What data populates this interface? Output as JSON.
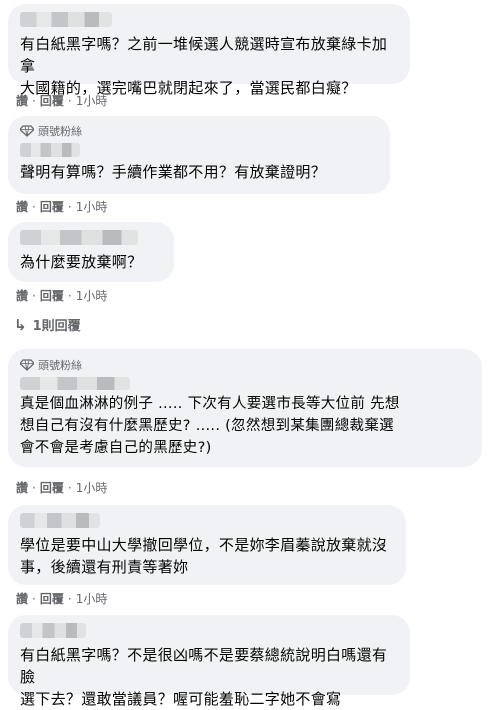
{
  "comments": [
    {
      "text_lines": [
        "有白紙黑字嗎？之前一堆候選人競選時宣布放棄綠卡加拿",
        "大國籍的，選完嘴巴就閉起來了，當選民都白癡？"
      ],
      "actions": {
        "like": "讚",
        "dot": "·",
        "reply": "回覆",
        "time": "1小時"
      }
    },
    {
      "badge": "頭號粉絲",
      "text_lines": [
        "聲明有算嗎？手續作業都不用？有放棄證明？"
      ],
      "actions": {
        "like": "讚",
        "dot": "·",
        "reply": "回覆",
        "time": "1小時"
      }
    },
    {
      "text_lines": [
        "為什麼要放棄啊？"
      ],
      "actions": {
        "like": "讚",
        "dot": "·",
        "reply": "回覆",
        "time": "1小時"
      }
    },
    {
      "badge": "頭號粉絲",
      "text_lines": [
        "真是個血淋淋的例子 ..... 下次有人要選市長等大位前 先想",
        "想自己有沒有什麼黑歷史? ..... (忽然想到某集團總裁棄選",
        "會不會是考慮自己的黑歷史?)"
      ],
      "actions": {
        "like": "讚",
        "dot": "·",
        "reply": "回覆",
        "time": "1小時"
      }
    },
    {
      "text_lines": [
        "學位是要中山大學撤回學位，不是妳李眉蓁說放棄就沒",
        "事，後續還有刑責等著妳"
      ],
      "actions": {
        "like": "讚",
        "dot": "·",
        "reply": "回覆",
        "time": "1小時"
      }
    },
    {
      "text_lines": [
        "有白紙黑字嗎？不是很凶嗎不是要蔡總統說明白嗎還有臉",
        "選下去？還敢當議員？喔可能羞恥二字她不會寫"
      ],
      "actions": {
        "like": "讚",
        "dot": "·",
        "reply": "回覆",
        "time": "1小時"
      }
    }
  ],
  "reply_link": {
    "arrow": "↳",
    "label": "1則回覆"
  },
  "colors": {
    "bubble": "#f0f2f5",
    "meta": "#65676b",
    "text": "#050505"
  }
}
